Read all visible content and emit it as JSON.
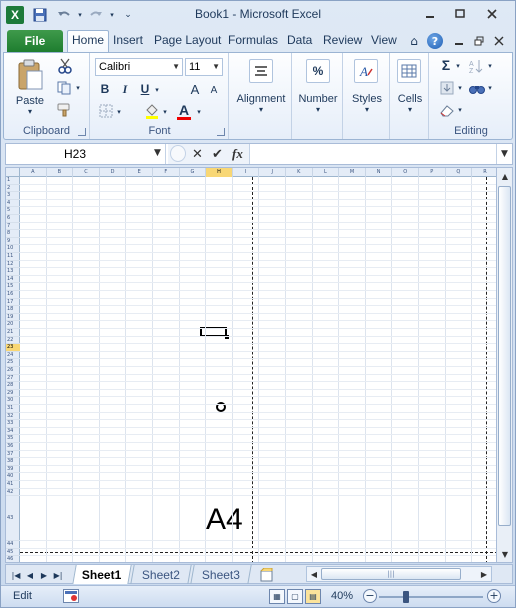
{
  "window": {
    "title": "Book1  -  Microsoft Excel"
  },
  "quick_access": {
    "app_icon": "X"
  },
  "window_controls": {
    "minimize": "▭",
    "maximize": "▢",
    "close": "✕"
  },
  "tabs": [
    "Home",
    "Insert",
    "Page Layout",
    "Formulas",
    "Data",
    "Review",
    "View"
  ],
  "file_tab": "File",
  "ribbon": {
    "clipboard": {
      "label": "Clipboard",
      "paste": "Paste"
    },
    "font": {
      "label": "Font",
      "name": "Calibri",
      "size": "11",
      "bold": "B",
      "italic": "I",
      "underline": "U",
      "grow": "A",
      "shrink": "A",
      "color": "A"
    },
    "alignment": {
      "label": "Alignment"
    },
    "number": {
      "label": "Number",
      "glyph": "%"
    },
    "styles": {
      "label": "Styles"
    },
    "cells": {
      "label": "Cells"
    },
    "editing": {
      "label": "Editing",
      "sum": "Σ"
    }
  },
  "formula_bar": {
    "name_box": "H23",
    "cancel": "✕",
    "enter": "✔",
    "fx": "fx",
    "value": ""
  },
  "grid": {
    "columns": [
      "A",
      "B",
      "C",
      "D",
      "E",
      "F",
      "G",
      "H",
      "I",
      "J",
      "K",
      "L",
      "M",
      "N",
      "O",
      "P",
      "Q",
      "R",
      "S"
    ],
    "selected_column": "H",
    "row_start": 1,
    "row_end": 46,
    "selected_row": 23,
    "page_label": "A4"
  },
  "sheets": [
    "Sheet1",
    "Sheet2",
    "Sheet3"
  ],
  "active_sheet": "Sheet1",
  "status": {
    "mode": "Edit",
    "zoom": "40%"
  }
}
